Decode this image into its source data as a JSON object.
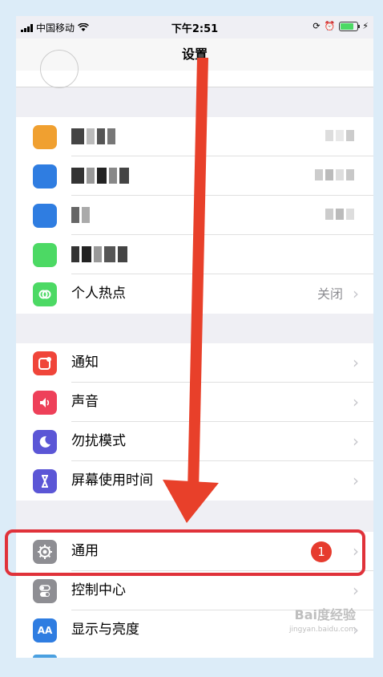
{
  "status_bar": {
    "carrier": "中国移动",
    "time": "下午2:51"
  },
  "nav": {
    "title": "设置"
  },
  "accounts_group": {
    "rows": [
      {
        "icon_color": "#f0a030",
        "obscured": true
      },
      {
        "icon_color": "#2f7de1",
        "obscured": true
      },
      {
        "icon_color": "#2f7de1",
        "obscured": true
      },
      {
        "icon_color": "#4cd964",
        "obscured": true
      },
      {
        "label": "个人热点",
        "value": "关闭",
        "icon": "link-icon",
        "icon_color": "#4cd964"
      }
    ]
  },
  "settings_group": {
    "rows": [
      {
        "label": "通知",
        "icon": "notification-icon",
        "icon_color": "#f0453a"
      },
      {
        "label": "声音",
        "icon": "speaker-icon",
        "icon_color": "#ee4059"
      },
      {
        "label": "勿扰模式",
        "icon": "moon-icon",
        "icon_color": "#5b56d6"
      },
      {
        "label": "屏幕使用时间",
        "icon": "hourglass-icon",
        "icon_color": "#5b56d6"
      }
    ]
  },
  "general_group": {
    "rows": [
      {
        "label": "通用",
        "icon": "gear-icon",
        "icon_color": "#8e8e93",
        "badge": "1"
      },
      {
        "label": "控制中心",
        "icon": "switches-icon",
        "icon_color": "#8e8e93"
      },
      {
        "label": "显示与亮度",
        "icon": "text-size-icon",
        "icon_color": "#2f7de1",
        "icon_text": "AA"
      }
    ]
  },
  "annotation": {
    "highlight_color": "#e0323a",
    "arrow_color": "#e8402a"
  },
  "watermark": {
    "brand": "Bai度经验",
    "url": "jingyan.baidu.com"
  }
}
